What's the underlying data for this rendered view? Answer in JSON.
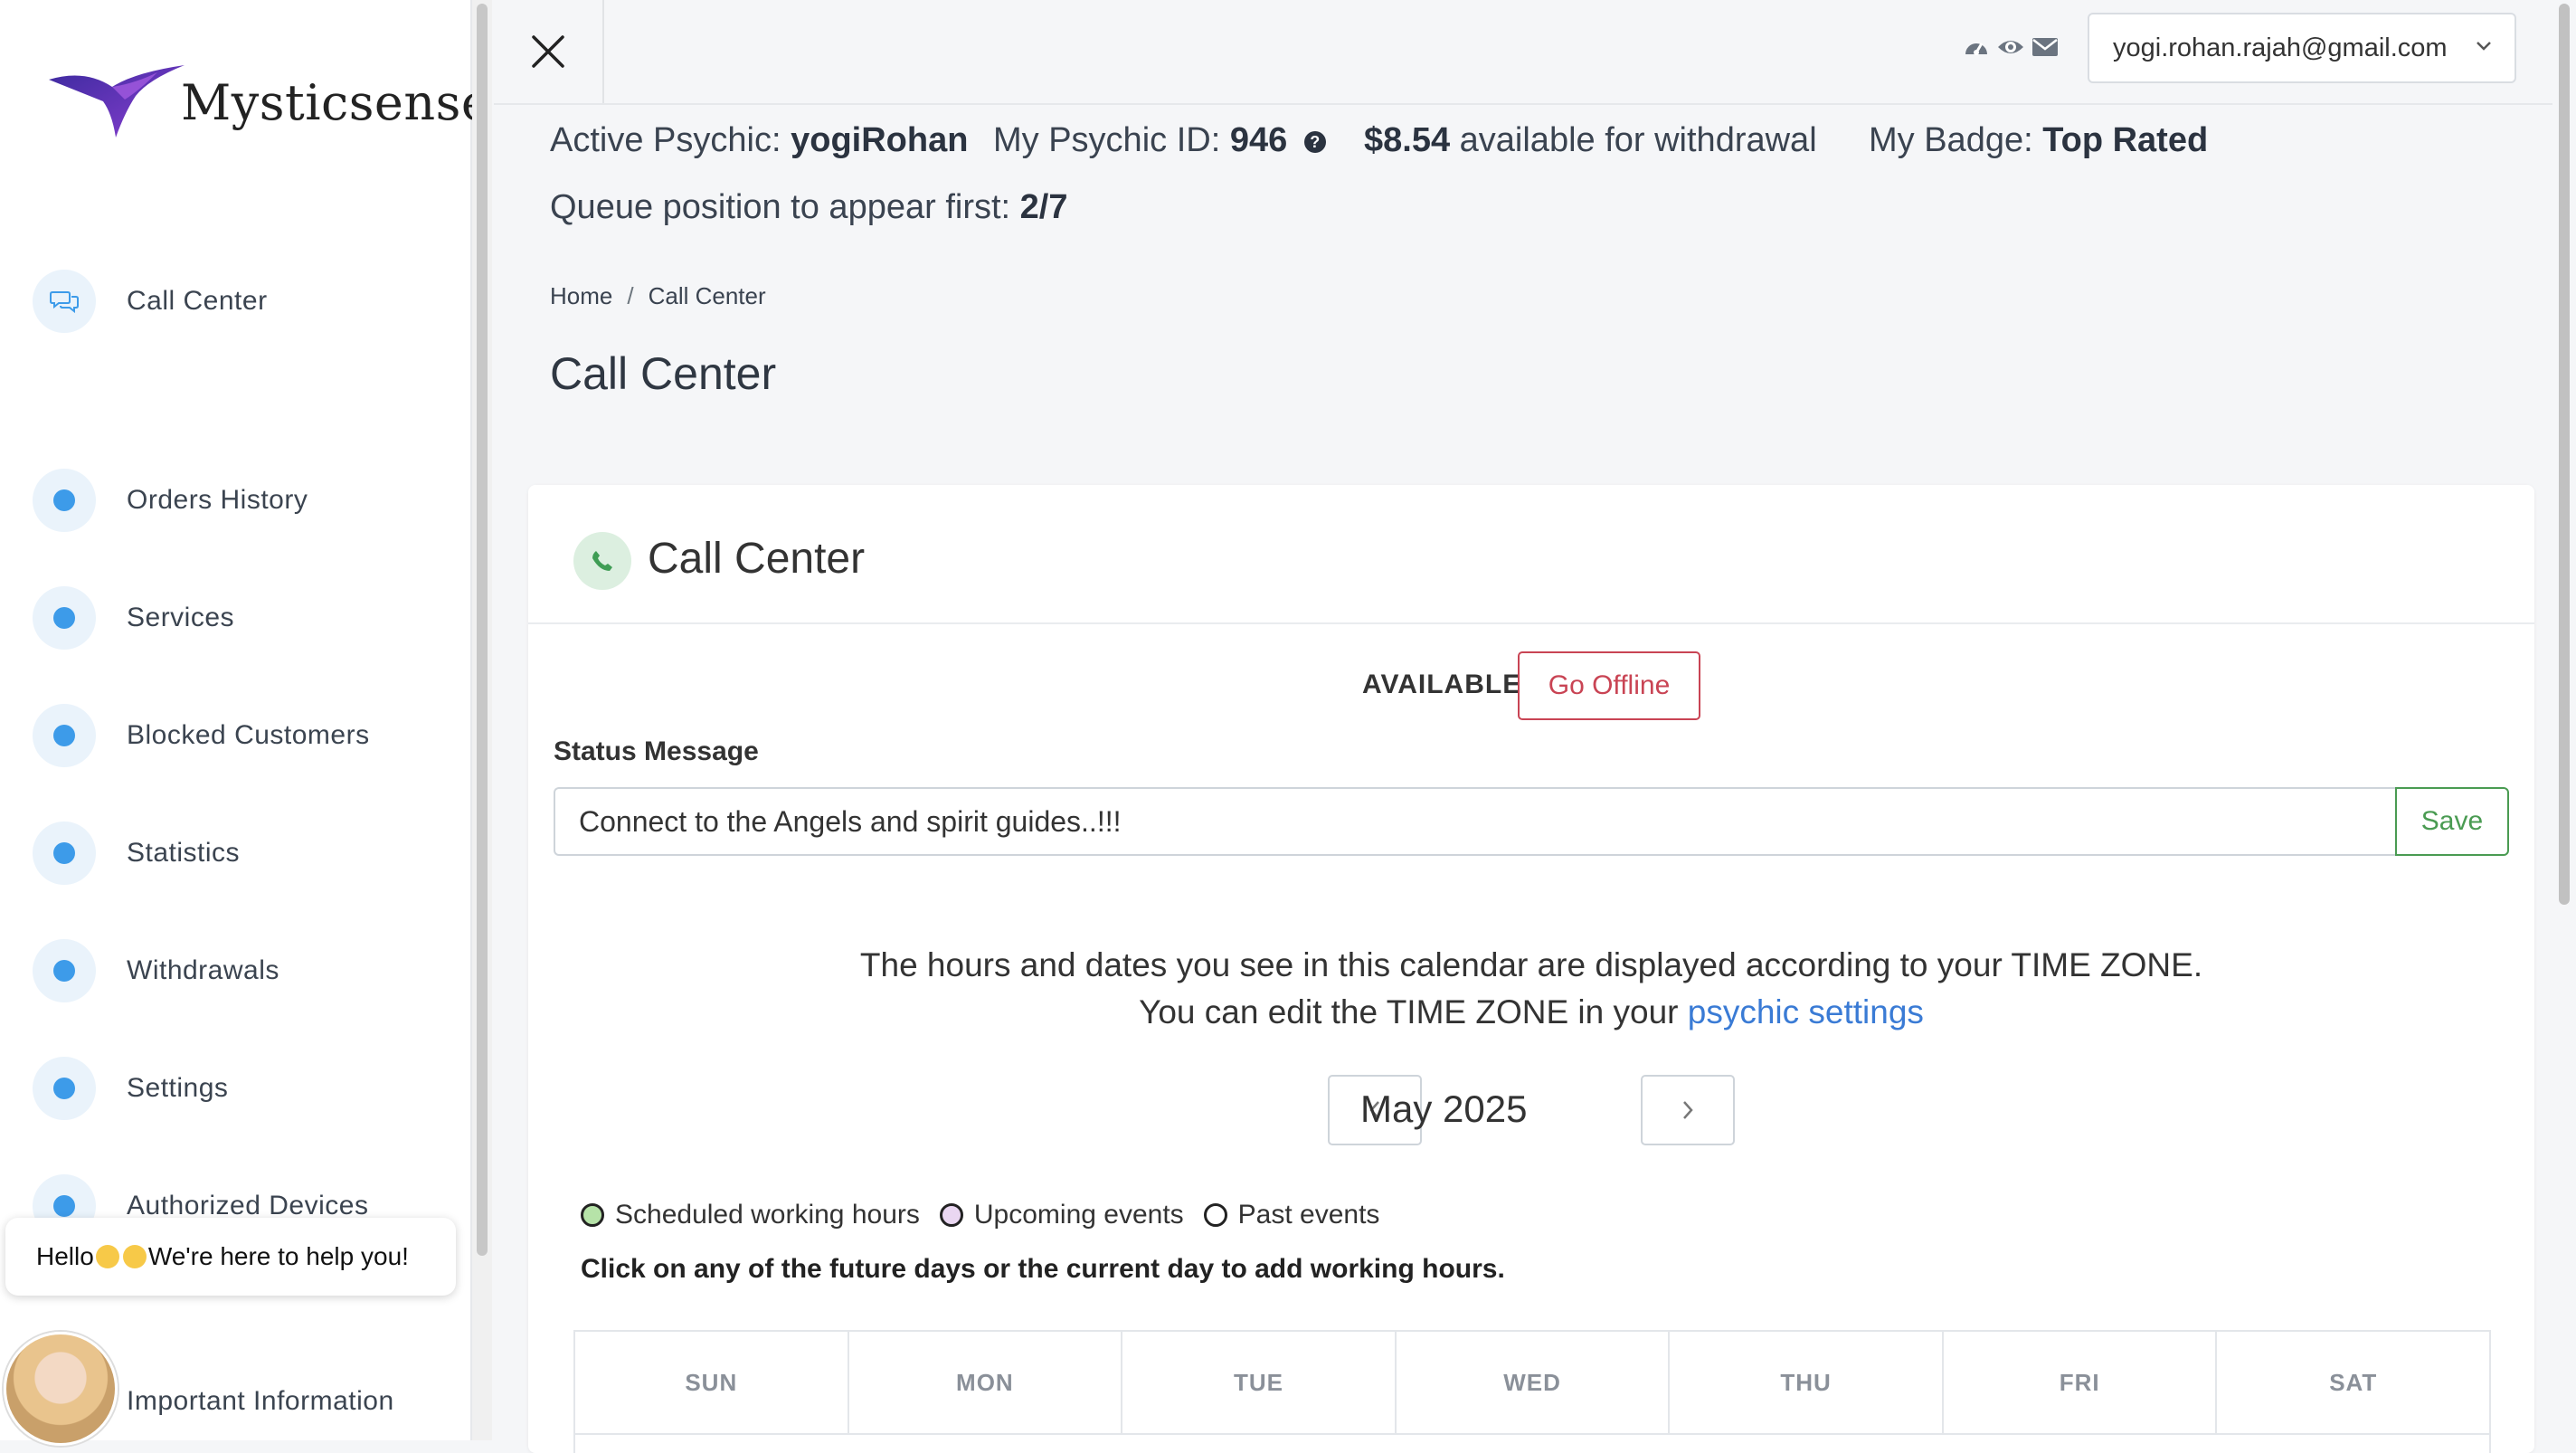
{
  "brand": {
    "name": "Mysticsense"
  },
  "sidebar": {
    "items": [
      {
        "label": "Call Center"
      },
      {
        "label": "Orders History"
      },
      {
        "label": "Services"
      },
      {
        "label": "Blocked Customers"
      },
      {
        "label": "Statistics"
      },
      {
        "label": "Withdrawals"
      },
      {
        "label": "Settings"
      },
      {
        "label": "Authorized Devices"
      },
      {
        "label": "Important Information"
      }
    ]
  },
  "chat": {
    "greeting_prefix": "Hello",
    "greeting_suffix": " We're here to help you!"
  },
  "header": {
    "user_email": "yogi.rohan.rajah@gmail.com",
    "icons": [
      "dashboard-icon",
      "eye-icon",
      "envelope-icon"
    ]
  },
  "info": {
    "active_psychic_label": "Active Psychic:",
    "active_psychic_value": "yogiRohan",
    "psychic_id_label": "My Psychic ID:",
    "psychic_id_value": "946",
    "withdrawal_amount": "$8.54",
    "withdrawal_text": "available for withdrawal",
    "badge_label": "My Badge:",
    "badge_value": "Top Rated",
    "queue_label": "Queue position to appear first:",
    "queue_value": "2/7"
  },
  "breadcrumb": {
    "home": "Home",
    "separator": "/",
    "current": "Call Center"
  },
  "page": {
    "title": "Call Center"
  },
  "card": {
    "title": "Call Center",
    "status_state": "AVAILABLE",
    "go_offline_label": "Go Offline",
    "status_message_label": "Status Message",
    "status_message_value": "Connect to the Angels and spirit guides..!!!",
    "save_label": "Save",
    "tz_line1": "The hours and dates you see in this calendar are displayed according to your TIME ZONE.",
    "tz_line2_prefix": "You can edit the TIME ZONE in your",
    "tz_link": "psychic settings",
    "month": "May 2025",
    "legend": [
      {
        "label": "Scheduled working hours",
        "color": "#b6e3a8"
      },
      {
        "label": "Upcoming events",
        "color": "#ead7f2"
      },
      {
        "label": "Past events",
        "color": "#ffffff"
      }
    ],
    "click_note": "Click on any of the future days or the current day to add working hours.",
    "weekdays": [
      "SUN",
      "MON",
      "TUE",
      "WED",
      "THU",
      "FRI",
      "SAT"
    ]
  },
  "colors": {
    "accent": "#3d9be9",
    "danger": "#c94454",
    "success": "#4a9b52",
    "link": "#3a7bd5"
  }
}
